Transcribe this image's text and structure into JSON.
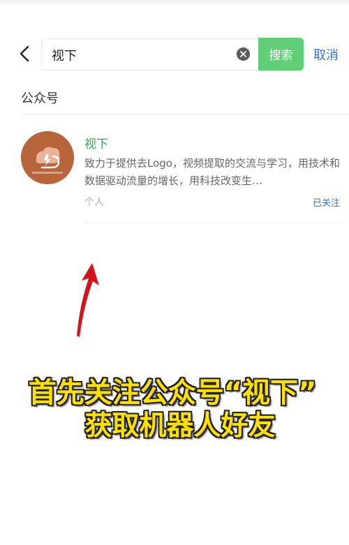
{
  "search": {
    "query": "视下",
    "button_label": "搜索",
    "cancel_label": "取消"
  },
  "section": {
    "title": "公众号"
  },
  "result": {
    "name": "视下",
    "description": "致力于提供去Logo，视频提取的交流与学习，用技术和数据驱动流量的增长，用科技改变生…",
    "account_type": "个人",
    "status": "已关注"
  },
  "overlay": {
    "line1": "首先关注公众号“视下”",
    "line2": "获取机器人好友"
  },
  "colors": {
    "search_button": "#61cf78",
    "account_name": "#35a64f",
    "link": "#3b74c4",
    "caption": "#ffe100",
    "arrow": "#d4141c",
    "avatar": "#b9653c"
  },
  "icons": {
    "back": "chevron-left-icon",
    "clear": "clear-icon",
    "avatar": "account-avatar-logo",
    "annotation": "red-arrow-up-icon"
  }
}
